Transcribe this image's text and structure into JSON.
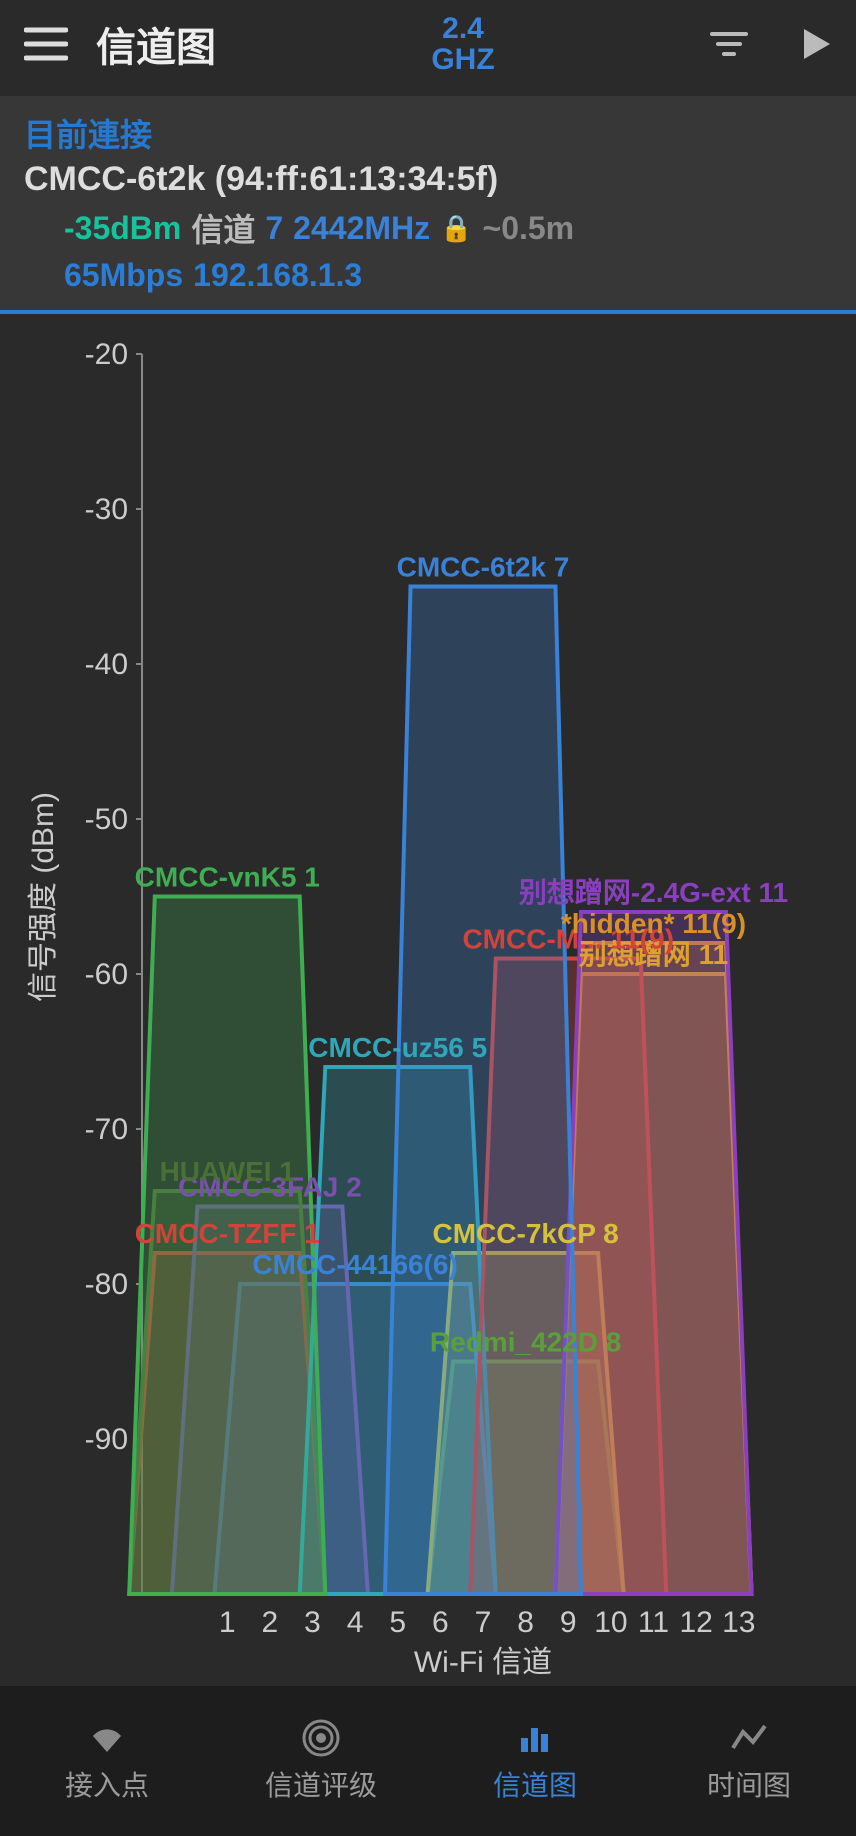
{
  "header": {
    "title": "信道图",
    "band_line1": "2.4",
    "band_line2": "GHZ"
  },
  "connection": {
    "heading": "目前連接",
    "ssid_line": "CMCC-6t2k (94:ff:61:13:34:5f)",
    "signal": "-35dBm",
    "channel_label": "信道",
    "channel": "7",
    "freq": "2442MHz",
    "distance": "~0.5m",
    "speed": "65Mbps",
    "ip": "192.168.1.3"
  },
  "chart_data": {
    "type": "area",
    "title": "",
    "xlabel": "Wi-Fi 信道",
    "ylabel": "信号强度 (dBm)",
    "ylim": [
      -100,
      -20
    ],
    "x_ticks": [
      1,
      2,
      3,
      4,
      5,
      6,
      7,
      8,
      9,
      10,
      11,
      12,
      13
    ],
    "y_ticks": [
      -20,
      -30,
      -40,
      -50,
      -60,
      -70,
      -80,
      -90
    ],
    "networks": [
      {
        "name": "CMCC-6t2k",
        "channel": 7,
        "dbm": -35,
        "width": 4,
        "color": "#3a82d8",
        "label": "CMCC-6t2k 7"
      },
      {
        "name": "CMCC-vnK5",
        "channel": 1,
        "dbm": -55,
        "width": 4,
        "color": "#3fae52",
        "label": "CMCC-vnK5 1"
      },
      {
        "name": "别想蹭网-2.4G-ext",
        "channel": 11,
        "dbm": -56,
        "width": 4,
        "color": "#8a3fbf",
        "label": "别想蹭网-2.4G-ext 11"
      },
      {
        "name": "*hidden*",
        "channel": 11,
        "dbm": -58,
        "width": 4,
        "color": "#d8902a",
        "label": "*hidden* 11(9)"
      },
      {
        "name": "CMCC-M",
        "channel": 9,
        "dbm": -59,
        "width": 4,
        "color": "#d2433a",
        "label": "CMCC-M... 11(9)"
      },
      {
        "name": "别想蹭网",
        "channel": 11,
        "dbm": -60,
        "width": 4,
        "color": "#e0a030",
        "label": "别想蹭网 11"
      },
      {
        "name": "CMCC-uz56",
        "channel": 5,
        "dbm": -66,
        "width": 4,
        "color": "#2fa7b8",
        "label": "CMCC-uz56 5"
      },
      {
        "name": "HUAWEI",
        "channel": 1,
        "dbm": -74,
        "width": 4,
        "color": "#4a7038",
        "label": "HUAWEI 1"
      },
      {
        "name": "CMCC-3FAJ",
        "channel": 2,
        "dbm": -75,
        "width": 4,
        "color": "#7a4fae",
        "label": "CMCC-3FAJ 2"
      },
      {
        "name": "CMCC-TZFF",
        "channel": 1,
        "dbm": -78,
        "width": 4,
        "color": "#d2433a",
        "label": "CMCC-TZFF 1"
      },
      {
        "name": "CMCC-7kCP",
        "channel": 8,
        "dbm": -78,
        "width": 4,
        "color": "#d6c23a",
        "label": "CMCC-7kCP 8"
      },
      {
        "name": "CMCC-44166",
        "channel": 4,
        "dbm": -80,
        "width": 6,
        "color": "#3a82d8",
        "label": "CMCC-44166(6)"
      },
      {
        "name": "Redmi_422D",
        "channel": 8,
        "dbm": -85,
        "width": 4,
        "color": "#5aa03a",
        "label": "Redmi_422D 8"
      }
    ]
  },
  "nav": {
    "items": [
      {
        "id": "ap",
        "label": "接入点"
      },
      {
        "id": "rating",
        "label": "信道评级"
      },
      {
        "id": "graph",
        "label": "信道图"
      },
      {
        "id": "time",
        "label": "时间图"
      }
    ],
    "active": "graph"
  }
}
